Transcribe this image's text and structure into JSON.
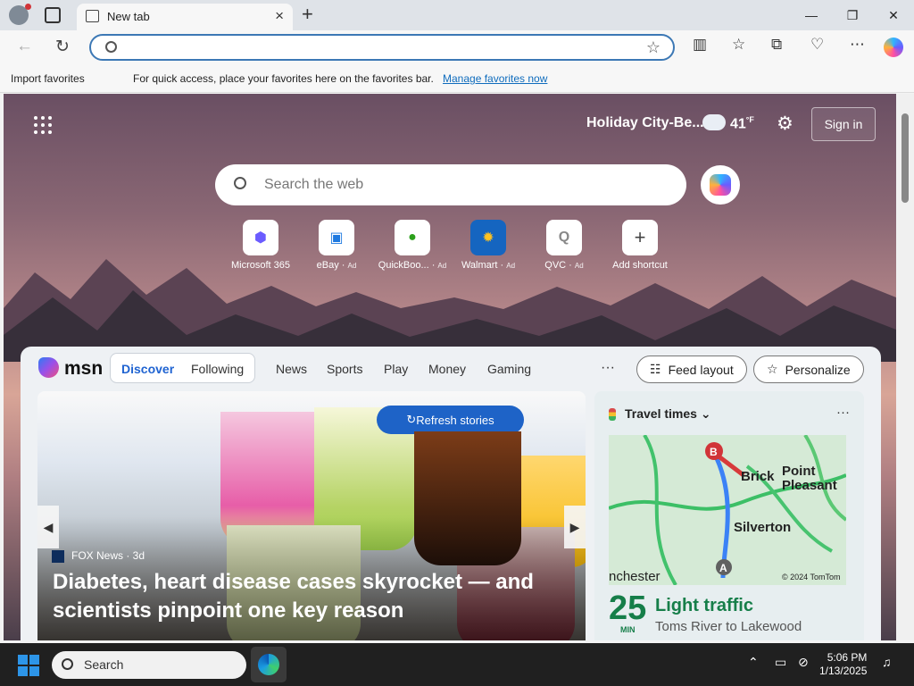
{
  "browser": {
    "tab_title": "New tab",
    "favorites_bar": {
      "import": "Import favorites",
      "message": "For quick access, place your favorites here on the favorites bar.",
      "manage_link": "Manage favorites now"
    }
  },
  "header": {
    "location": "Holiday City-Be...",
    "temperature": "41",
    "temperature_unit": "°F",
    "sign_in": "Sign in"
  },
  "search": {
    "placeholder": "Search the web"
  },
  "shortcuts": [
    {
      "label": "Microsoft 365",
      "ad": ""
    },
    {
      "label": "eBay",
      "ad": "Ad"
    },
    {
      "label": "QuickBoo...",
      "ad": "Ad"
    },
    {
      "label": "Walmart",
      "ad": "Ad"
    },
    {
      "label": "QVC",
      "ad": "Ad"
    },
    {
      "label": "Add shortcut",
      "ad": ""
    }
  ],
  "feed": {
    "brand": "msn",
    "tabs": [
      "Discover",
      "Following",
      "News",
      "Sports",
      "Play",
      "Money",
      "Gaming"
    ],
    "more": "···",
    "feed_layout": "Feed layout",
    "personalize": "Personalize",
    "refresh": "Refresh stories",
    "source": "FOX News · 3d",
    "headline": "Diabetes, heart disease cases skyrocket — and scientists pinpoint one key reason"
  },
  "travel": {
    "title": "Travel times",
    "map_labels": {
      "brick": "Brick",
      "point_pleasant": "Point Pleasant",
      "silverton": "Silverton",
      "chester": "nchester",
      "copyright": "© 2024 TomTom"
    },
    "minutes": "25",
    "min_label": "MIN",
    "status": "Light traffic",
    "route": "Toms River to Lakewood"
  },
  "taskbar": {
    "search": "Search",
    "time": "5:06 PM",
    "date": "1/13/2025"
  },
  "icons": {
    "apps": "apps-grid-icon",
    "settings": "gear-icon",
    "search": "search-icon",
    "copilot": "copilot-icon"
  },
  "colors": {
    "accent": "#1e63c7",
    "msn_blue": "#1f63d1",
    "traffic_green": "#167e49"
  }
}
